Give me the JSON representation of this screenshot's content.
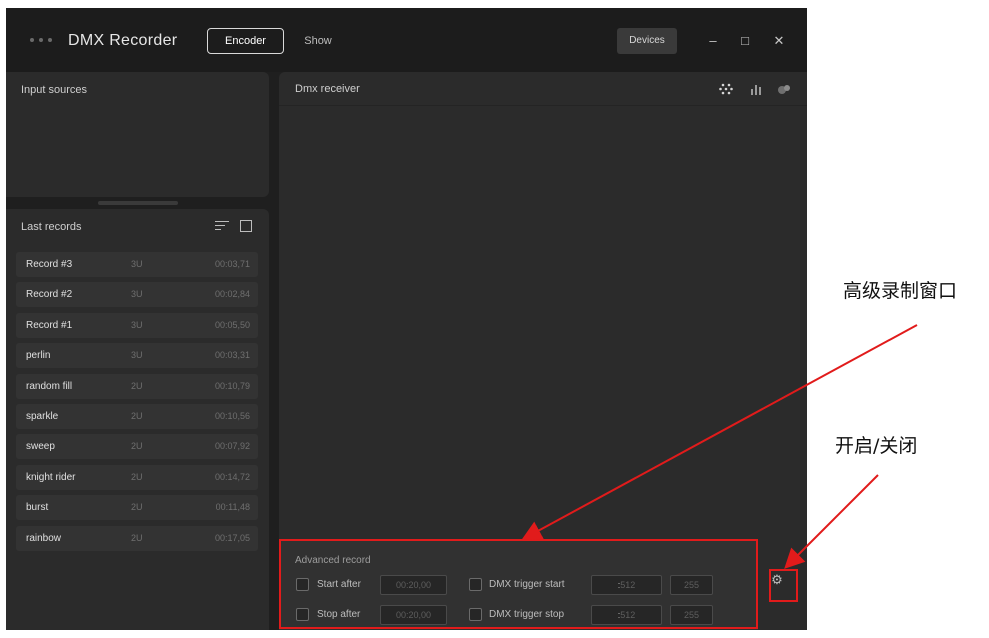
{
  "titlebar": {
    "app_title": "DMX Recorder",
    "tabs": [
      {
        "label": "Encoder",
        "active": true
      },
      {
        "label": "Show",
        "active": false
      }
    ],
    "devices_label": "Devices",
    "minimize_glyph": "–",
    "maximize_glyph": "□",
    "close_glyph": "✕"
  },
  "input_sources": {
    "title": "Input sources"
  },
  "last_records": {
    "title": "Last records",
    "items": [
      {
        "name": "Record #3",
        "universes": "3U",
        "duration": "00:03,71"
      },
      {
        "name": "Record #2",
        "universes": "3U",
        "duration": "00:02,84"
      },
      {
        "name": "Record #1",
        "universes": "3U",
        "duration": "00:05,50"
      },
      {
        "name": "perlin",
        "universes": "3U",
        "duration": "00:03,31"
      },
      {
        "name": "random fill",
        "universes": "2U",
        "duration": "00:10,79"
      },
      {
        "name": "sparkle",
        "universes": "2U",
        "duration": "00:10,56"
      },
      {
        "name": "sweep",
        "universes": "2U",
        "duration": "00:07,92"
      },
      {
        "name": "knight rider",
        "universes": "2U",
        "duration": "00:14,72"
      },
      {
        "name": "burst",
        "universes": "2U",
        "duration": "00:11,48"
      },
      {
        "name": "rainbow",
        "universes": "2U",
        "duration": "00:17,05"
      }
    ]
  },
  "dmx_receiver": {
    "title": "Dmx receiver",
    "icons": [
      "dots-grid-icon",
      "bar-chart-icon",
      "circles-icon"
    ]
  },
  "advanced_record": {
    "title": "Advanced record",
    "start_after_label": "Start after",
    "start_after_value": "00:20,00",
    "stop_after_label": "Stop after",
    "stop_after_value": "00:20,00",
    "trigger_start_label": "DMX trigger start",
    "trigger_start_channel": "512",
    "trigger_start_value": "255",
    "trigger_stop_label": "DMX trigger stop",
    "trigger_stop_channel": "512",
    "trigger_stop_value": "255",
    "colon": ":"
  },
  "annotations": {
    "advanced_window": "高级录制窗口",
    "toggle": "开启/关闭",
    "color": "#e11b1b"
  }
}
